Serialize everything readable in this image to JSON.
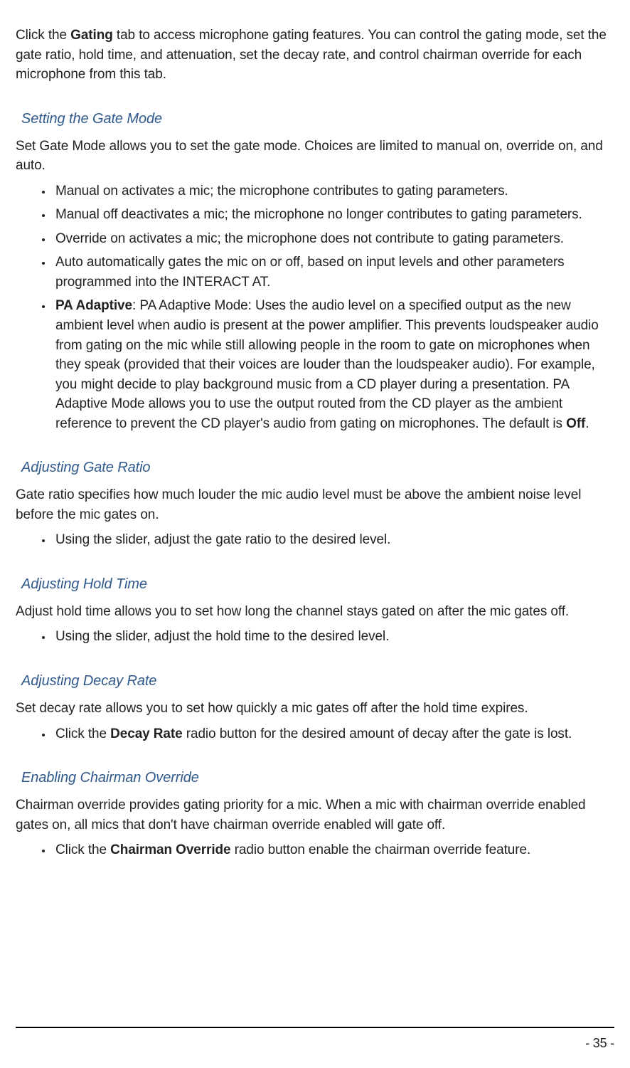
{
  "intro": {
    "pre": "Click the ",
    "bold": "Gating",
    "post": " tab to access microphone gating features. You can control the gating mode, set the gate ratio, hold time, and attenuation, set the decay rate, and control chairman override for each microphone from this tab."
  },
  "s1": {
    "title": "Setting the Gate Mode",
    "body": "Set Gate Mode allows you to set the gate mode. Choices are limited to manual on, override on, and auto.",
    "items": {
      "i1": "Manual on activates a mic; the microphone contributes to gating parameters.",
      "i2": "Manual off deactivates a mic; the microphone no longer contributes to gating parameters.",
      "i3": "Override on activates a mic; the microphone does not contribute to gating parameters.",
      "i4": "Auto automatically gates the mic on or off, based on input levels and other parameters programmed into the INTERACT AT.",
      "i5_bold": "PA Adaptive",
      "i5_rest": ": PA Adaptive Mode: Uses the audio level on a specified output as the new ambient level when audio is present at the power amplifier. This prevents loudspeaker audio from gating on the mic while still allowing people in the room to gate on microphones when they speak (provided that their voices are louder than the loudspeaker audio). For example, you might decide to play background music from a CD player during a presentation. PA Adaptive Mode allows you to use the output routed from the CD player as the ambient reference to prevent the CD player's audio from gating on microphones. The default is ",
      "i5_off": "Off",
      "i5_period": "."
    }
  },
  "s2": {
    "title": "Adjusting Gate Ratio",
    "body": "Gate ratio specifies how much louder the mic audio level must be above the ambient noise level before the mic gates on.",
    "items": {
      "i1": "Using the slider, adjust the gate ratio to the desired level."
    }
  },
  "s3": {
    "title": "Adjusting Hold Time",
    "body": "Adjust hold time allows you to set how long the channel stays gated on after the mic gates off.",
    "items": {
      "i1": "Using the slider, adjust the hold time to the desired level."
    }
  },
  "s4": {
    "title": "Adjusting Decay Rate",
    "body": "Set decay rate allows you to set how quickly a mic gates off after the hold time expires.",
    "items": {
      "i1_pre": "Click the ",
      "i1_bold": "Decay Rate",
      "i1_post": " radio button for the desired amount of decay after the gate is lost."
    }
  },
  "s5": {
    "title": "Enabling Chairman Override",
    "body": "Chairman override provides gating priority for a mic. When a mic with chairman override enabled gates on, all mics that don't have chairman override enabled will gate off.",
    "items": {
      "i1_pre": "Click the ",
      "i1_bold": "Chairman Override",
      "i1_post": " radio button enable the chairman override feature."
    }
  },
  "page_number": "- 35 -"
}
